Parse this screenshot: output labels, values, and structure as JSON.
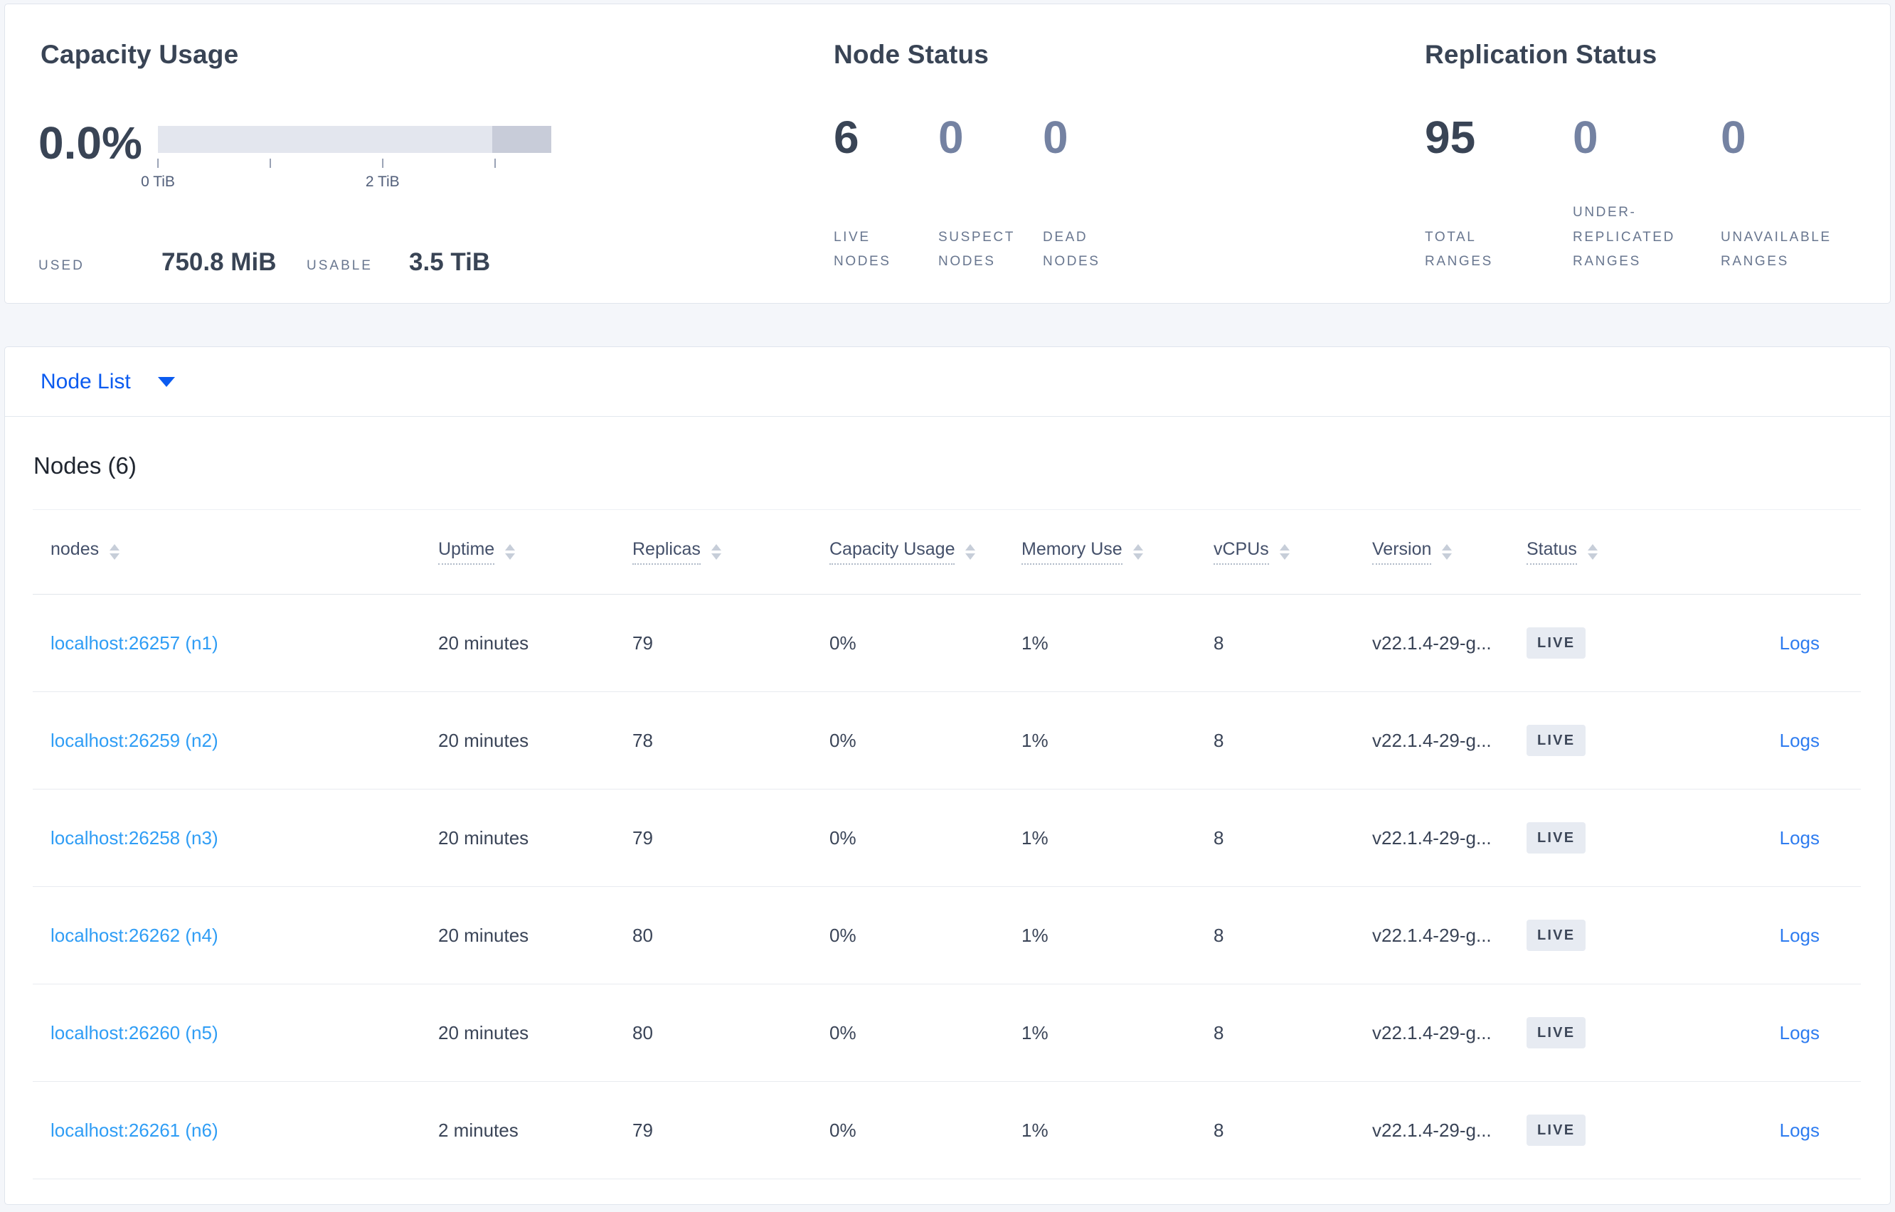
{
  "colors": {
    "page_background": "#f4f6fa",
    "card_background": "#ffffff",
    "primary_text": "#394455",
    "dim_stat_text": "#7482a2",
    "selector_blue": "#0b5bf0",
    "node_link_blue": "#2f9df5",
    "logs_link_blue": "#2e7cf0",
    "badge_background": "#e7ebf2",
    "bar_track": "#e3e6ee",
    "bar_segment": "#c8ccd9"
  },
  "summary": {
    "capacity": {
      "title": "Capacity Usage",
      "percent": "0.0%",
      "bar": {
        "segment_left": "85%",
        "segment_width": "15%"
      },
      "ticks": [
        {
          "label": "0 TiB",
          "left": "0%"
        },
        {
          "label": "",
          "left": "28.6%"
        },
        {
          "label": "2 TiB",
          "left": "57.1%"
        },
        {
          "label": "",
          "left": "85.7%"
        }
      ],
      "used_label": "USED",
      "used_value": "750.8 MiB",
      "usable_label": "USABLE",
      "usable_value": "3.5 TiB"
    },
    "node_status": {
      "title": "Node Status",
      "stats": [
        {
          "value": "6",
          "label": "LIVE\nNODES",
          "dim": false
        },
        {
          "value": "0",
          "label": "SUSPECT\nNODES",
          "dim": true
        },
        {
          "value": "0",
          "label": "DEAD\nNODES",
          "dim": true
        }
      ]
    },
    "replication": {
      "title": "Replication Status",
      "stats": [
        {
          "value": "95",
          "label": "TOTAL\nRANGES",
          "dim": false
        },
        {
          "value": "0",
          "label": "UNDER-\nREPLICATED\nRANGES",
          "dim": true
        },
        {
          "value": "0",
          "label": "UNAVAILABLE\nRANGES",
          "dim": true
        }
      ]
    }
  },
  "view_selector": {
    "label": "Node List"
  },
  "nodes_section": {
    "heading": "Nodes (6)",
    "columns": [
      {
        "label": "nodes",
        "dotted": false
      },
      {
        "label": "Uptime",
        "dotted": true
      },
      {
        "label": "Replicas",
        "dotted": true
      },
      {
        "label": "Capacity Usage",
        "dotted": true
      },
      {
        "label": "Memory Use",
        "dotted": true
      },
      {
        "label": "vCPUs",
        "dotted": true
      },
      {
        "label": "Version",
        "dotted": true
      },
      {
        "label": "Status",
        "dotted": true
      }
    ],
    "rows": [
      {
        "node": "localhost:26257 (n1)",
        "uptime": "20 minutes",
        "replicas": "79",
        "capacity": "0%",
        "memory": "1%",
        "vcpus": "8",
        "version": "v22.1.4-29-g...",
        "status": "LIVE",
        "logs": "Logs"
      },
      {
        "node": "localhost:26259 (n2)",
        "uptime": "20 minutes",
        "replicas": "78",
        "capacity": "0%",
        "memory": "1%",
        "vcpus": "8",
        "version": "v22.1.4-29-g...",
        "status": "LIVE",
        "logs": "Logs"
      },
      {
        "node": "localhost:26258 (n3)",
        "uptime": "20 minutes",
        "replicas": "79",
        "capacity": "0%",
        "memory": "1%",
        "vcpus": "8",
        "version": "v22.1.4-29-g...",
        "status": "LIVE",
        "logs": "Logs"
      },
      {
        "node": "localhost:26262 (n4)",
        "uptime": "20 minutes",
        "replicas": "80",
        "capacity": "0%",
        "memory": "1%",
        "vcpus": "8",
        "version": "v22.1.4-29-g...",
        "status": "LIVE",
        "logs": "Logs"
      },
      {
        "node": "localhost:26260 (n5)",
        "uptime": "20 minutes",
        "replicas": "80",
        "capacity": "0%",
        "memory": "1%",
        "vcpus": "8",
        "version": "v22.1.4-29-g...",
        "status": "LIVE",
        "logs": "Logs"
      },
      {
        "node": "localhost:26261 (n6)",
        "uptime": "2 minutes",
        "replicas": "79",
        "capacity": "0%",
        "memory": "1%",
        "vcpus": "8",
        "version": "v22.1.4-29-g...",
        "status": "LIVE",
        "logs": "Logs"
      }
    ]
  }
}
